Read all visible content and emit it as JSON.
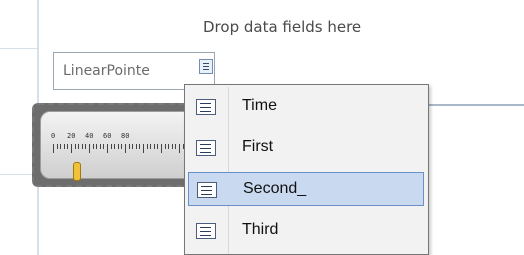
{
  "pivot": {
    "drop_hint": "Drop data fields here",
    "field_label": "LinearPointe"
  },
  "gauge": {
    "tick_labels": [
      "0",
      "20",
      "40",
      "60",
      "80"
    ]
  },
  "menu": {
    "items": [
      {
        "label": "Time",
        "selected": false,
        "icon": "field-icon"
      },
      {
        "label": "First",
        "selected": false,
        "icon": "field-icon"
      },
      {
        "label": "Second_",
        "selected": true,
        "icon": "field-icon"
      },
      {
        "label": "Third",
        "selected": false,
        "icon": "field-icon"
      }
    ]
  },
  "colors": {
    "selection_bg": "#c9d9ef",
    "selection_border": "#6b8fc8",
    "pointer": "#f2c13a",
    "range": "#e07760"
  }
}
